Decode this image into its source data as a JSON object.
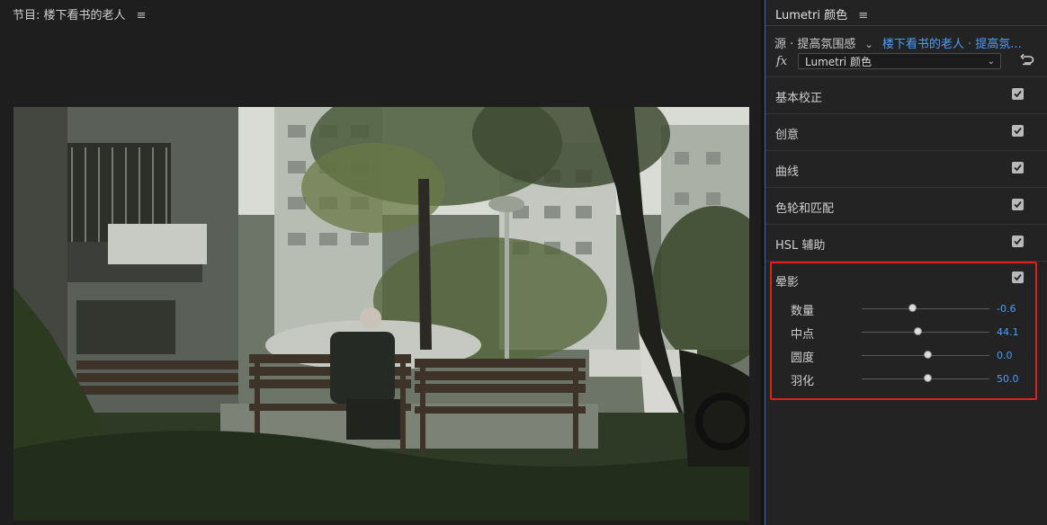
{
  "program": {
    "title": "节目: 楼下看书的老人",
    "menu_glyph": "≡"
  },
  "panel": {
    "tab_title": "Lumetri 颜色",
    "menu_glyph": "≡",
    "source_label": "源 · 提高氛围感",
    "clip_link": "楼下看书的老人 · 提高氛...",
    "fx_label": "fx",
    "effect_name": "Lumetri 颜色",
    "sections": [
      {
        "label": "基本校正",
        "checked": true
      },
      {
        "label": "创意",
        "checked": true
      },
      {
        "label": "曲线",
        "checked": true
      },
      {
        "label": "色轮和匹配",
        "checked": true
      },
      {
        "label": "HSL 辅助",
        "checked": true
      }
    ],
    "vignette": {
      "label": "晕影",
      "checked": true,
      "params": [
        {
          "label": "数量",
          "value": "-0.6",
          "position": 0.4
        },
        {
          "label": "中点",
          "value": "44.1",
          "position": 0.44
        },
        {
          "label": "圆度",
          "value": "0.0",
          "position": 0.52
        },
        {
          "label": "羽化",
          "value": "50.0",
          "position": 0.52
        }
      ]
    }
  },
  "colors": {
    "accent": "#4a9fff",
    "highlight_box": "#e0201a"
  }
}
